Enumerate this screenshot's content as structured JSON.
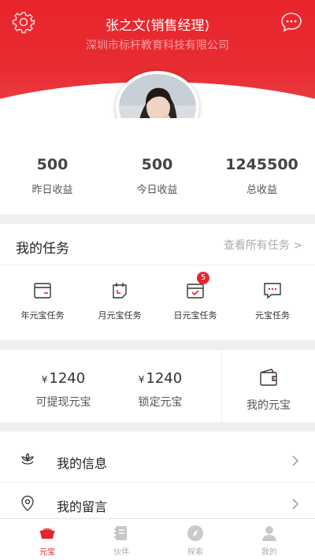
{
  "header": {
    "name": "张之文(销售经理)",
    "company": "深圳市标杆教育科技有限公司",
    "settings_icon": "gear-icon",
    "chat_icon": "chat-bubble-icon",
    "accent_color": "#e8242b"
  },
  "stats": [
    {
      "value": "500",
      "label": "昨日收益"
    },
    {
      "value": "500",
      "label": "今日收益"
    },
    {
      "value": "1245500",
      "label": "总收益"
    }
  ],
  "tasks": {
    "title": "我的任务",
    "view_all": "查看所有任务 >",
    "items": [
      {
        "label": "年元宝任务",
        "icon": "wallet-card-icon"
      },
      {
        "label": "月元宝任务",
        "icon": "calendar-icon"
      },
      {
        "label": "日元宝任务",
        "icon": "calendar-check-icon",
        "badge": "5"
      },
      {
        "label": "元宝任务",
        "icon": "message-dots-icon"
      }
    ]
  },
  "wallet": {
    "withdrawable": {
      "currency": "¥",
      "amount": "1240",
      "label": "可提现元宝"
    },
    "locked": {
      "currency": "¥",
      "amount": "1240",
      "label": "锁定元宝"
    },
    "mine": {
      "label": "我的元宝",
      "icon": "wallet-icon"
    }
  },
  "menu": [
    {
      "label": "我的信息",
      "icon": "flower-icon"
    },
    {
      "label": "我的留言",
      "icon": "location-pin-icon"
    }
  ],
  "tabbar": [
    {
      "label": "元宝",
      "icon": "ingot-icon",
      "active": true
    },
    {
      "label": "伙伴",
      "icon": "notebook-icon",
      "active": false
    },
    {
      "label": "探索",
      "icon": "compass-icon",
      "active": false
    },
    {
      "label": "我的",
      "icon": "person-icon",
      "active": false
    }
  ]
}
